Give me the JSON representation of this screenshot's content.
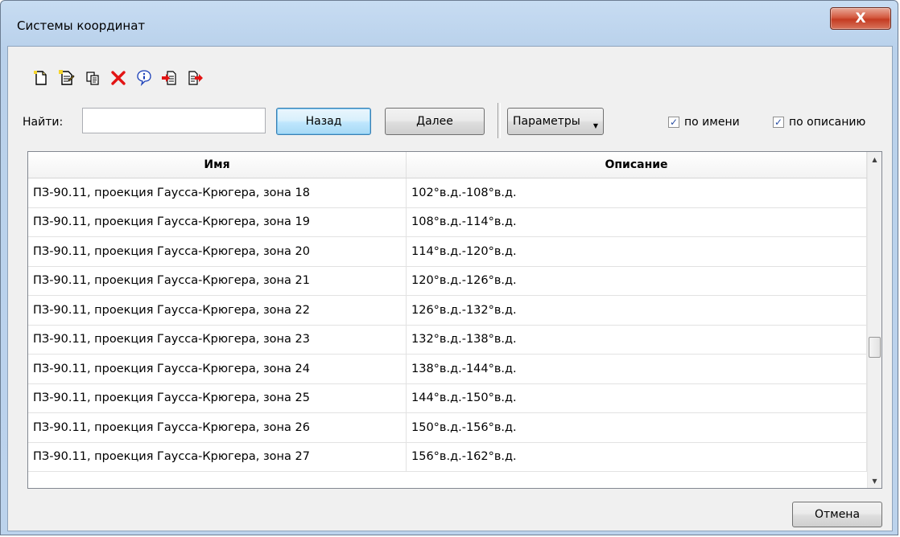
{
  "window": {
    "title": "Системы координат",
    "close_glyph": "X"
  },
  "toolbar": {
    "buttons": [
      {
        "name": "new-icon"
      },
      {
        "name": "edit-icon"
      },
      {
        "name": "copy-icon"
      },
      {
        "name": "delete-icon"
      },
      {
        "name": "info-icon"
      },
      {
        "name": "import-icon"
      },
      {
        "name": "export-icon"
      }
    ]
  },
  "search": {
    "label": "Найти:",
    "value": "",
    "back_label": "Назад",
    "next_label": "Далее",
    "params_label": "Параметры",
    "by_name_label": "по имени",
    "by_name_checked": true,
    "by_desc_label": "по описанию",
    "by_desc_checked": true
  },
  "table": {
    "columns": [
      "Имя",
      "Описание"
    ],
    "rows": [
      [
        "ПЗ-90.11, проекция Гаусса-Крюгера, зона 18",
        "102°в.д.-108°в.д."
      ],
      [
        "ПЗ-90.11, проекция Гаусса-Крюгера, зона 19",
        "108°в.д.-114°в.д."
      ],
      [
        "ПЗ-90.11, проекция Гаусса-Крюгера, зона 20",
        "114°в.д.-120°в.д."
      ],
      [
        "ПЗ-90.11, проекция Гаусса-Крюгера, зона 21",
        "120°в.д.-126°в.д."
      ],
      [
        "ПЗ-90.11, проекция Гаусса-Крюгера, зона 22",
        "126°в.д.-132°в.д."
      ],
      [
        "ПЗ-90.11, проекция Гаусса-Крюгера, зона 23",
        "132°в.д.-138°в.д."
      ],
      [
        "ПЗ-90.11, проекция Гаусса-Крюгера, зона 24",
        "138°в.д.-144°в.д."
      ],
      [
        "ПЗ-90.11, проекция Гаусса-Крюгера, зона 25",
        "144°в.д.-150°в.д."
      ],
      [
        "ПЗ-90.11, проекция Гаусса-Крюгера, зона 26",
        "150°в.д.-156°в.д."
      ],
      [
        "ПЗ-90.11, проекция Гаусса-Крюгера, зона 27",
        "156°в.д.-162°в.д."
      ]
    ]
  },
  "footer": {
    "cancel_label": "Отмена"
  }
}
